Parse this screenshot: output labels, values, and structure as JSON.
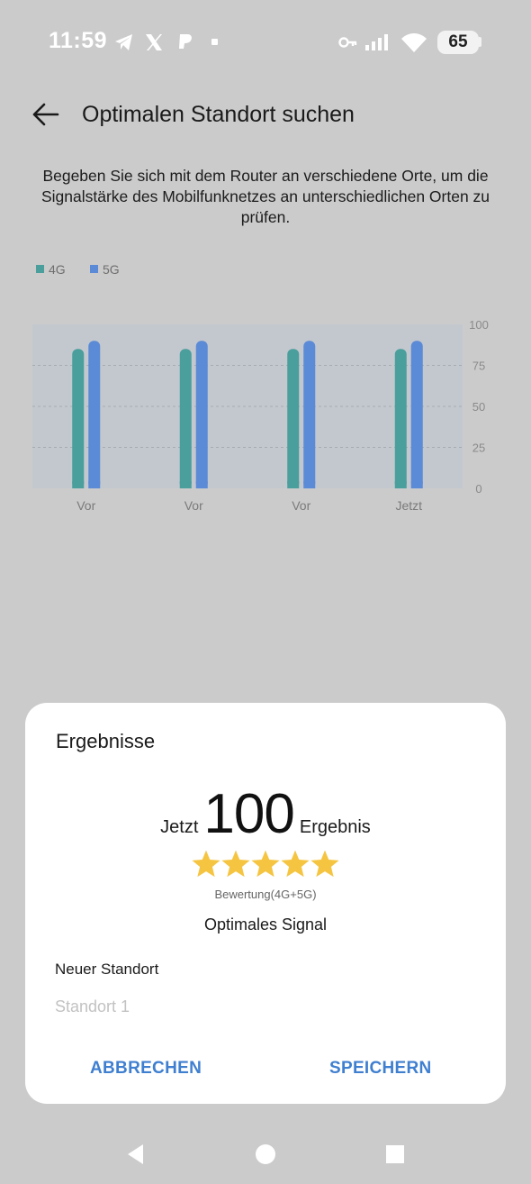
{
  "status_bar": {
    "time": "11:59",
    "battery": "65",
    "icons": [
      "telegram-icon",
      "x-icon",
      "paypal-icon",
      "dot-icon",
      "key-icon",
      "signal-icon",
      "wifi-icon",
      "battery-icon"
    ]
  },
  "header": {
    "title": "Optimalen Standort suchen",
    "back_icon": "arrow-left-icon"
  },
  "description": "Begeben Sie sich mit dem Router an verschiedene Orte, um die Signalstärke des Mobilfunknetzes an unterschiedlichen Orten zu prüfen.",
  "colors": {
    "series_4g": "#4a9e9c",
    "series_5g": "#5b8ad6",
    "chart_bg": "#c3c8cf",
    "accent": "#3f7fd0",
    "star": "#f5c542"
  },
  "chart_data": {
    "type": "bar",
    "categories": [
      "Vor",
      "Vor",
      "Vor",
      "Jetzt"
    ],
    "series": [
      {
        "name": "4G",
        "values": [
          85,
          85,
          85,
          85
        ]
      },
      {
        "name": "5G",
        "values": [
          90,
          90,
          90,
          90
        ]
      }
    ],
    "y_ticks": [
      "100",
      "75",
      "50",
      "25",
      "0"
    ],
    "ylim": [
      0,
      100
    ],
    "grid": true,
    "legend": "top-left"
  },
  "dialog": {
    "title": "Ergebnisse",
    "score_prefix": "Jetzt",
    "score": "100",
    "score_suffix": "Ergebnis",
    "stars": 5,
    "rating_note": "Bewertung(4G+5G)",
    "signal_text": "Optimales Signal",
    "field_label": "Neuer Standort",
    "field_placeholder": "Standort 1",
    "cancel_label": "ABBRECHEN",
    "save_label": "SPEICHERN"
  },
  "nav": {
    "back": "back-triangle-icon",
    "home": "home-circle-icon",
    "recents": "recents-square-icon"
  }
}
